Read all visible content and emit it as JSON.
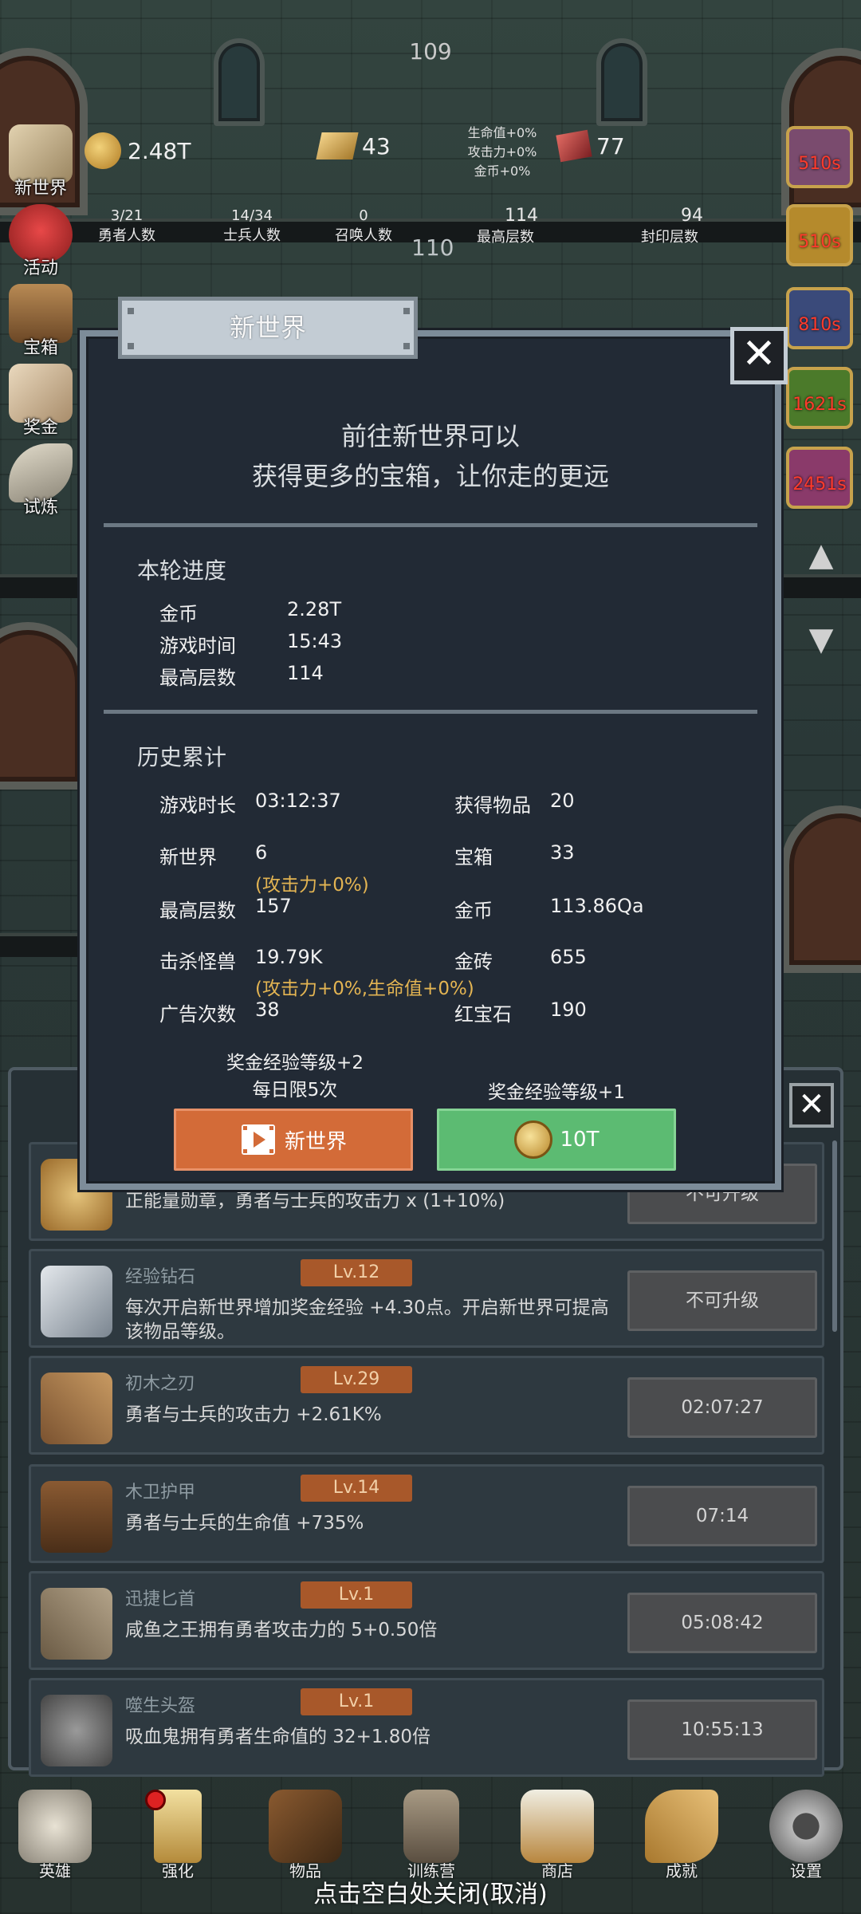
{
  "top": {
    "floor_number": "109",
    "gold": "2.48T",
    "gold_bricks": "43",
    "rubies": "77",
    "bonus": {
      "hp": "生命值+0%",
      "atk": "攻击力+0%",
      "gold": "金币+0%"
    },
    "counts": [
      {
        "value": "3/21",
        "label": "勇者人数"
      },
      {
        "value": "14/34",
        "label": "士兵人数"
      },
      {
        "value": "0",
        "label": "召唤人数"
      },
      {
        "value": "114",
        "label": "最高层数"
      },
      {
        "value": "94",
        "label": "封印层数"
      }
    ],
    "floor_marker": "110"
  },
  "left_menu": [
    {
      "label": "新世界",
      "icon": "scroll-map-icon"
    },
    {
      "label": "活动",
      "icon": "heart-icon"
    },
    {
      "label": "宝箱",
      "icon": "chest-icon"
    },
    {
      "label": "奖金",
      "icon": "envelope-icon"
    },
    {
      "label": "试炼",
      "icon": "feather-icon"
    }
  ],
  "right_timers": [
    "510s",
    "510s",
    "810s",
    "1621s",
    "2451s"
  ],
  "modal": {
    "title": "新世界",
    "description_line1": "前往新世界可以",
    "description_line2": "获得更多的宝箱，让你走的更远",
    "current_section_title": "本轮进度",
    "current": [
      {
        "key": "金币",
        "value": "2.28T"
      },
      {
        "key": "游戏时间",
        "value": "15:43"
      },
      {
        "key": "最高层数",
        "value": "114"
      }
    ],
    "history_section_title": "历史累计",
    "history_left": [
      {
        "key": "游戏时长",
        "value": "03:12:37",
        "note": ""
      },
      {
        "key": "新世界",
        "value": "6",
        "note": "(攻击力+0%)"
      },
      {
        "key": "最高层数",
        "value": "157",
        "note": ""
      },
      {
        "key": "击杀怪兽",
        "value": "19.79K",
        "note": "(攻击力+0%,生命值+0%)"
      },
      {
        "key": "广告次数",
        "value": "38",
        "note": ""
      }
    ],
    "history_right": [
      {
        "key": "获得物品",
        "value": "20"
      },
      {
        "key": "宝箱",
        "value": "33"
      },
      {
        "key": "金币",
        "value": "113.86Qa"
      },
      {
        "key": "金砖",
        "value": "655"
      },
      {
        "key": "红宝石",
        "value": "190"
      }
    ],
    "free_option_line1": "奖金经验等级+2",
    "free_option_line2": "每日限5次",
    "paid_option": "奖金经验等级+1",
    "video_button_label": "新世界",
    "coin_button_label": "10T"
  },
  "items_list": [
    {
      "name": "",
      "level": "",
      "desc": "正能量勋章，勇者与士兵的攻击力 x (1+10%)",
      "button": "不可升级"
    },
    {
      "name": "经验钻石",
      "level": "Lv.12",
      "desc": "每次开启新世界增加奖金经验 +4.30点。开启新世界可提高该物品等级。",
      "button": "不可升级"
    },
    {
      "name": "初木之刃",
      "level": "Lv.29",
      "desc": "勇者与士兵的攻击力 +2.61K%",
      "button": "02:07:27"
    },
    {
      "name": "木卫护甲",
      "level": "Lv.14",
      "desc": "勇者与士兵的生命值 +735%",
      "button": "07:14"
    },
    {
      "name": "迅捷匕首",
      "level": "Lv.1",
      "desc": "咸鱼之王拥有勇者攻击力的 5+0.50倍",
      "button": "05:08:42"
    },
    {
      "name": "噬生头盔",
      "level": "Lv.1",
      "desc": "吸血鬼拥有勇者生命值的 32+1.80倍",
      "button": "10:55:13"
    }
  ],
  "bottom_nav": [
    {
      "label": "英雄",
      "icon": "skull-icon"
    },
    {
      "label": "强化",
      "icon": "candle-icon"
    },
    {
      "label": "物品",
      "icon": "book-icon"
    },
    {
      "label": "训练营",
      "icon": "lantern-icon"
    },
    {
      "label": "商店",
      "icon": "beer-mug-icon"
    },
    {
      "label": "成就",
      "icon": "key-icon"
    },
    {
      "label": "设置",
      "icon": "gear-icon"
    }
  ],
  "close_hint": "点击空白处关闭(取消)"
}
